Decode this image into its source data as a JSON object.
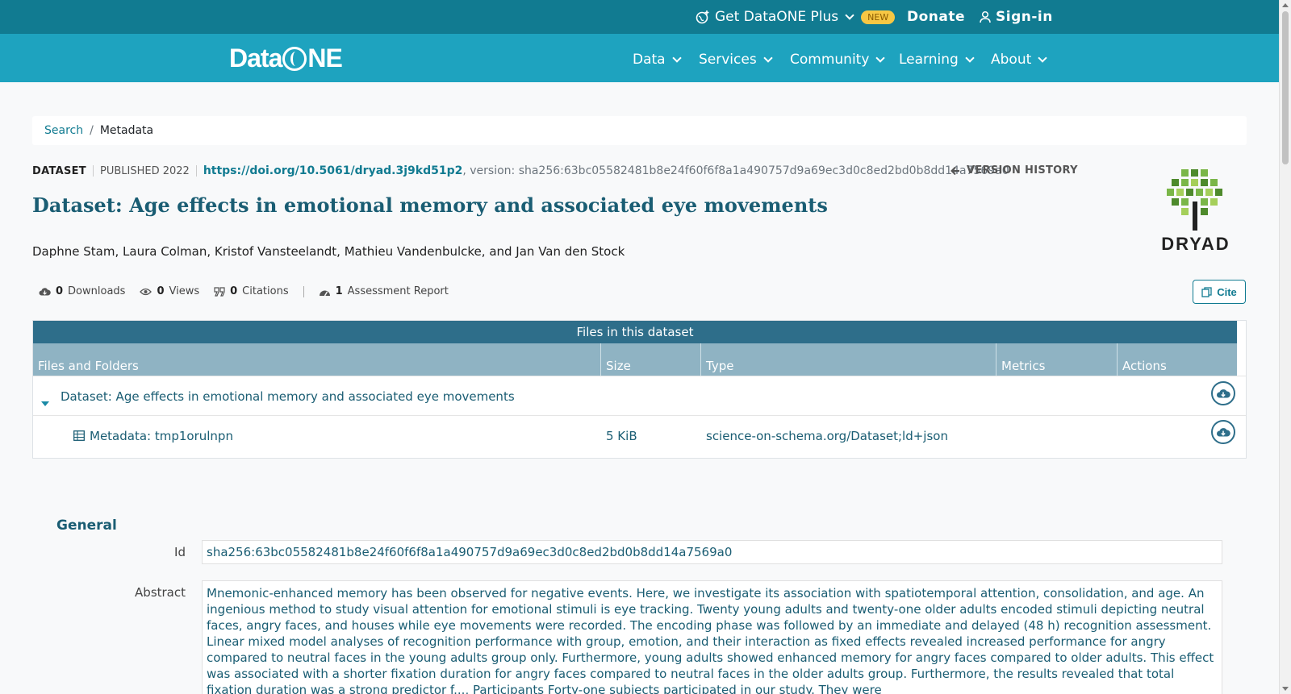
{
  "topbar": {
    "plus_label": "Get DataONE Plus",
    "new_badge": "NEW",
    "donate": "Donate",
    "signin": "Sign-in"
  },
  "navbar": {
    "logo": "DataONE",
    "items": [
      "Data",
      "Services",
      "Community",
      "Learning",
      "About"
    ]
  },
  "breadcrumb": {
    "search": "Search",
    "separator": "/",
    "current": "Metadata"
  },
  "dataset": {
    "type": "DATASET",
    "published": "PUBLISHED 2022",
    "doi": "https://doi.org/10.5061/dryad.3j9kd51p2",
    "version_text": ", version: sha256:63bc05582481b8e24f60f6f8a1a490757d9a69ec3d0c8ed2bd0b8dd14a7569a0",
    "version_history": "VERSION HISTORY",
    "title": "Dataset: Age effects in emotional memory and associated eye movements",
    "authors": "Daphne Stam, Laura Colman, Kristof Vansteelandt, Mathieu Vandenbulcke, and Jan Van den Stock",
    "repository_logo": "DRYAD"
  },
  "metrics": {
    "downloads_count": "0",
    "downloads_label": "Downloads",
    "views_count": "0",
    "views_label": "Views",
    "citations_count": "0",
    "citations_label": "Citations",
    "assessment_count": "1",
    "assessment_label": "Assessment Report",
    "cite_button": "Cite"
  },
  "files": {
    "header": "Files in this dataset",
    "columns": [
      "Files and Folders",
      "Size",
      "Type",
      "Metrics",
      "Actions"
    ],
    "rows": [
      {
        "name": "Dataset: Age effects in emotional memory and associated eye movements",
        "size": "",
        "type": ""
      },
      {
        "name": "Metadata: tmp1orulnpn",
        "size": "5 KiB",
        "type": "science-on-schema.org/Dataset;ld+json"
      }
    ]
  },
  "general": {
    "title": "General",
    "id_label": "Id",
    "id_value": "sha256:63bc05582481b8e24f60f6f8a1a490757d9a69ec3d0c8ed2bd0b8dd14a7569a0",
    "abstract_label": "Abstract",
    "abstract_value": "Mnemonic-enhanced memory has been observed for negative events. Here, we investigate its association with spatiotemporal attention, consolidation, and age. An ingenious method to study visual attention for emotional stimuli is eye tracking. Twenty young adults and twenty-one older adults encoded stimuli depicting neutral faces, angry faces, and houses while eye movements were recorded. The encoding phase was followed by an immediate and delayed (48 h) recognition assessment. Linear mixed model analyses of recognition performance with group, emotion, and their interaction as fixed effects revealed increased performance for angry compared to neutral faces in the young adults group only. Furthermore, young adults showed enhanced memory for angry faces compared to older adults. This effect was associated with a shorter fixation duration for angry faces compared to neutral faces in the older adults group. Furthermore, the results revealed that total fixation duration was a strong predictor f..., Participants Forty-one subjects participated in our study. They were"
  },
  "colors": {
    "topbar": "#117b91",
    "navbar": "#1ea3bf",
    "accent": "#117b91",
    "title": "#1a5d73",
    "table_header": "#2e6e8a",
    "table_columns": "#8fb3c3",
    "dryad_green": "#7ab648"
  }
}
